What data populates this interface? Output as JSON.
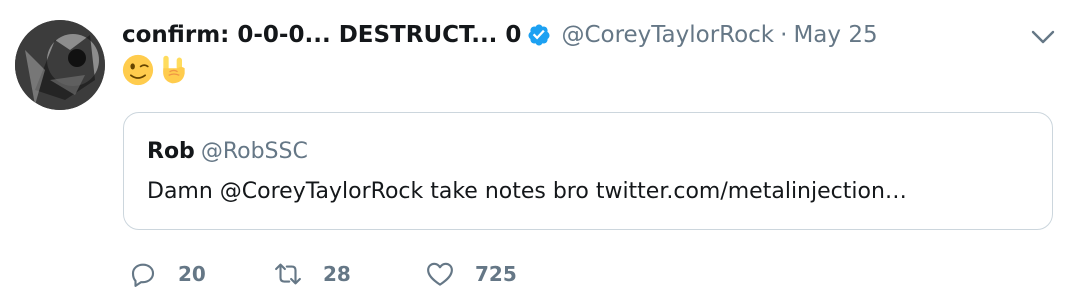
{
  "tweet": {
    "author_name": "confirm: 0-0-0... DESTRUCT... 0",
    "author_handle": "@CoreyTaylorRock",
    "separator": "·",
    "date": "May 25",
    "verified": true,
    "emojis": [
      "winking-face-emoji",
      "sign-of-the-horns-emoji"
    ]
  },
  "quoted_tweet": {
    "author_name": "Rob",
    "author_handle": "@RobSSC",
    "text": "Damn @CoreyTaylorRock take notes bro twitter.com/metalinjection…"
  },
  "actions": {
    "reply_count": "20",
    "retweet_count": "28",
    "like_count": "725"
  },
  "colors": {
    "verified_badge": "#1da1f2",
    "secondary_text": "#657786",
    "border": "#ccd6dd",
    "emoji_yellow": "#ffcc4d"
  },
  "icons": [
    "avatar",
    "verified-badge-icon",
    "chevron-down-icon",
    "reply-icon",
    "retweet-icon",
    "like-icon"
  ]
}
